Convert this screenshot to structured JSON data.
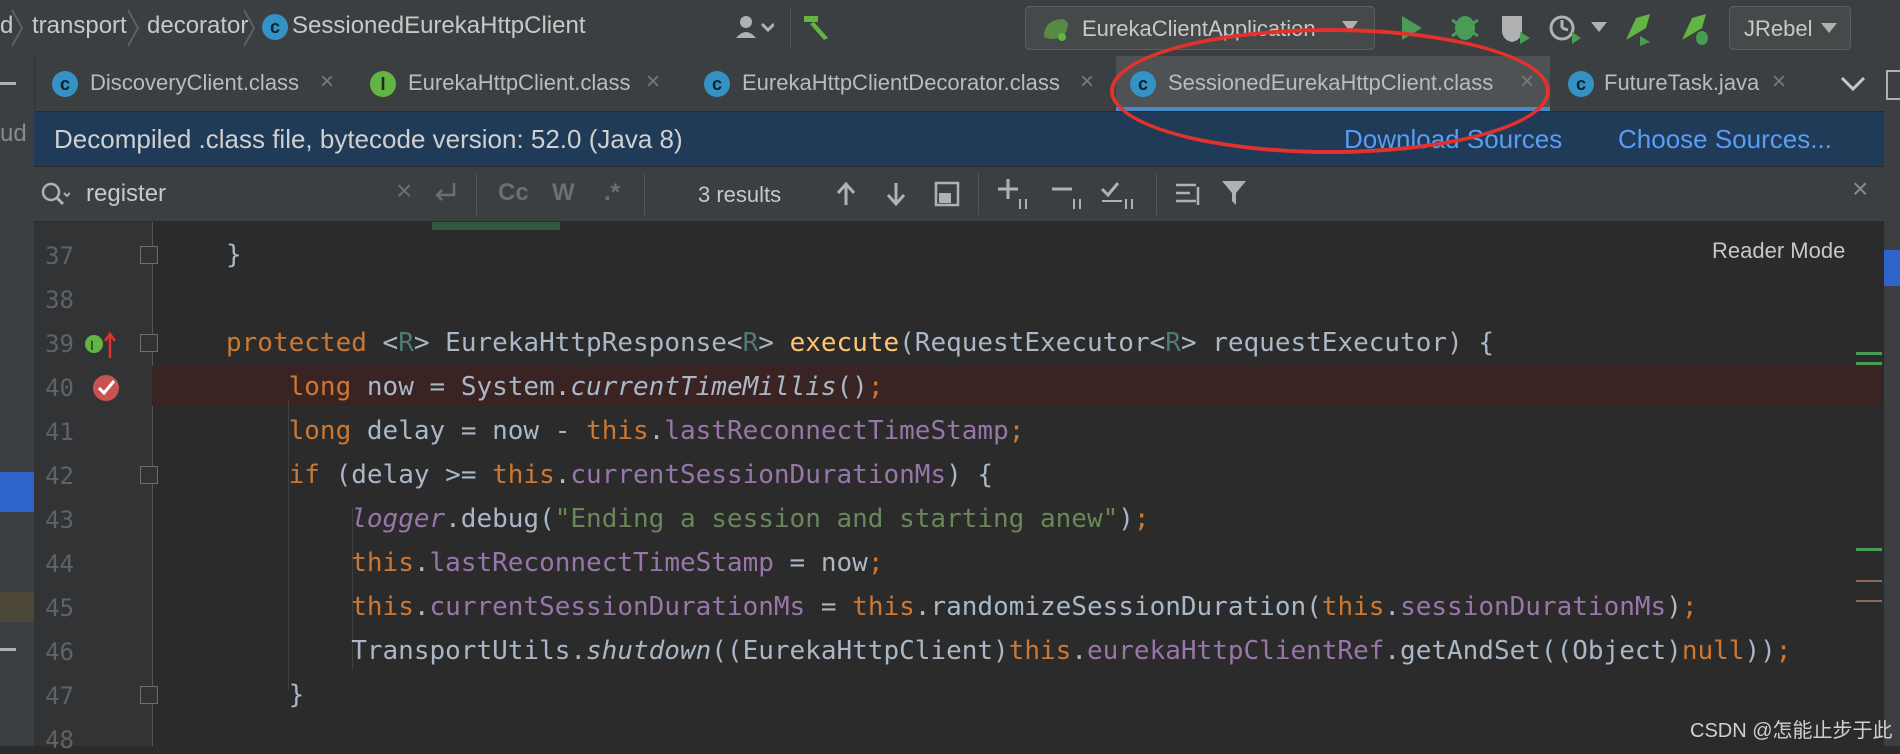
{
  "breadcrumb": {
    "items": [
      "d",
      "transport",
      "decorator",
      "SessionedEurekaHttpClient"
    ]
  },
  "toolbar": {
    "run_config": "EurekaClientApplication",
    "jrebel": "JRebel"
  },
  "tabs": [
    {
      "label": "DiscoveryClient.class",
      "icon": "class-icon",
      "active": false
    },
    {
      "label": "EurekaHttpClient.class",
      "icon": "interface-icon",
      "active": false
    },
    {
      "label": "EurekaHttpClientDecorator.class",
      "icon": "class-icon",
      "active": false
    },
    {
      "label": "SessionedEurekaHttpClient.class",
      "icon": "class-icon",
      "active": true
    },
    {
      "label": "FutureTask.java",
      "icon": "class-icon",
      "active": false
    }
  ],
  "infobar": {
    "message": "Decompiled .class file, bytecode version: 52.0 (Java 8)",
    "download_sources": "Download Sources",
    "choose_sources": "Choose Sources..."
  },
  "search": {
    "query": "register",
    "case_label": "Cc",
    "word_label": "W",
    "regex_label": ".*",
    "results": "3 results"
  },
  "editor": {
    "reader_mode": "Reader Mode",
    "line_numbers": [
      "37",
      "38",
      "39",
      "40",
      "41",
      "42",
      "43",
      "44",
      "45",
      "46",
      "47",
      "48"
    ]
  },
  "sidebar_fragment": "ud",
  "watermark": "CSDN @怎能止步于此",
  "colors": {
    "keyword": "#cc7832",
    "function": "#ffc66d",
    "field": "#9876aa",
    "string": "#6a8759",
    "annotation_circle": "#e2322b",
    "link": "#589df6"
  }
}
